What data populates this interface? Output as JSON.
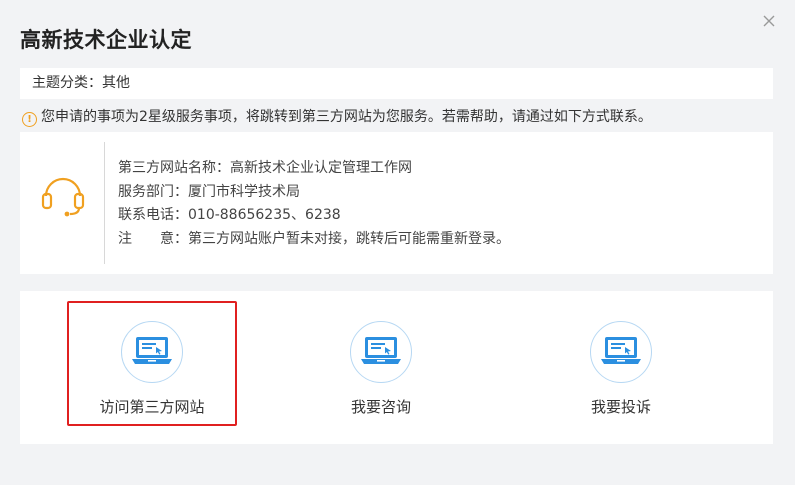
{
  "dialog": {
    "title": "高新技术企业认定",
    "close_icon": "close-icon"
  },
  "category": {
    "text": "主题分类：其他"
  },
  "notice": {
    "icon": "warning-circle-icon",
    "text": "您申请的事项为2星级服务事项，将跳转到第三方网站为您服务。若需帮助，请通过如下方式联系。"
  },
  "info": {
    "icon": "headset-icon",
    "site_name": "第三方网站名称：高新技术企业认定管理工作网",
    "department": "服务部门：厦门市科学技术局",
    "phone": "联系电话：010-88656235、6238",
    "note": "注　　意：第三方网站账户暂未对接，跳转后可能需重新登录。"
  },
  "actions": [
    {
      "label": "访问第三方网站",
      "icon": "laptop-icon",
      "highlighted": true
    },
    {
      "label": "我要咨询",
      "icon": "laptop-icon",
      "highlighted": false
    },
    {
      "label": "我要投诉",
      "icon": "laptop-icon",
      "highlighted": false
    }
  ],
  "colors": {
    "accent_blue": "#2b8fe0",
    "icon_orange": "#f0a020",
    "highlight_red": "#e02020"
  }
}
